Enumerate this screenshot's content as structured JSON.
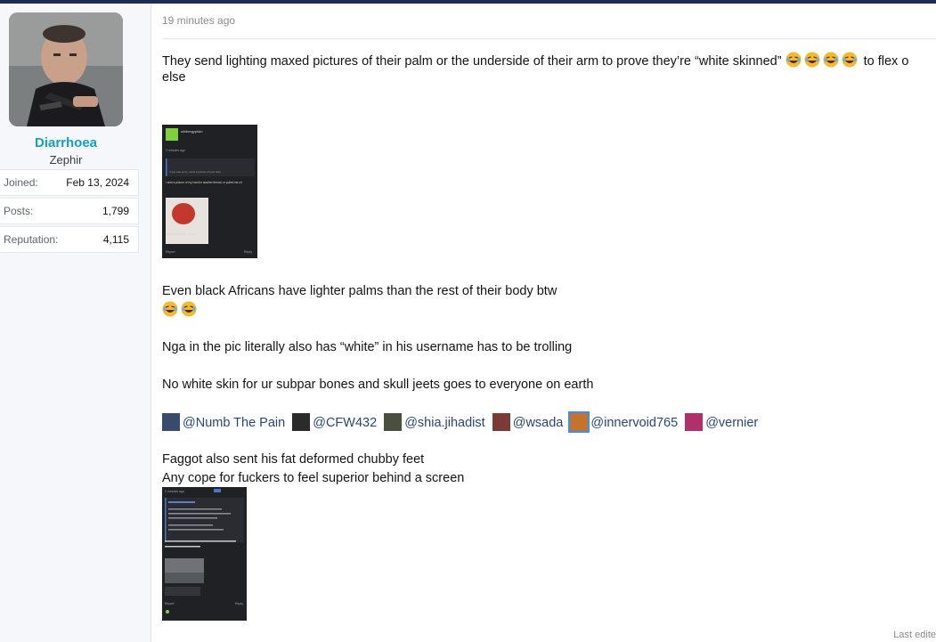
{
  "user": {
    "name": "Diarrhoea",
    "title": "Zephir",
    "stats": [
      {
        "label": "Joined:",
        "value": "Feb 13, 2024"
      },
      {
        "label": "Posts:",
        "value": "1,799"
      },
      {
        "label": "Reputation:",
        "value": "4,115"
      }
    ]
  },
  "post": {
    "time": "19 minutes ago",
    "line1": "They send lighting maxed pictures of their palm or the underside of their arm to prove they’re “white skinned”",
    "line1_tail": " to flex o",
    "line1_wrap": "else",
    "line2": "Even black Africans have lighter palms than the rest of their body btw",
    "line3": "Nga in the pic literally also has “white” in his username has to be trolling",
    "line4": "No white skin for ur subpar bones and skull jeets goes to everyone on earth",
    "mentions": [
      "@Numb The Pain",
      "@CFW432",
      "@shia.jihadist",
      "@wsada",
      "@innervoid765",
      "@vernier"
    ],
    "line5": "Faggot also sent his fat deformed chubby feet",
    "line6": "Any cope for fuckers to feel superior behind a screen",
    "last_edit": "Last edite"
  },
  "screenshots": {
    "shot1": {
      "username": "whiteegyptian",
      "time": "3 minutes ago",
      "quote": "If you use pi ice, send a picture of your face",
      "text": "I sent a picture of my hand in another thread, m pulled via url",
      "file": "IMG2023/11/09/2_02.jpg",
      "report": "Report",
      "reply": "Reply"
    },
    "shot2": {
      "time": "2 minutes ago",
      "report": "Report",
      "reply": "Reply"
    }
  },
  "emoji": {
    "name": "face-with-tears-of-joy",
    "color": "#f5b82e"
  },
  "colors": {
    "accent": "#12a0c6",
    "mention": "#2a4677",
    "topbar": "#1d2a55"
  }
}
